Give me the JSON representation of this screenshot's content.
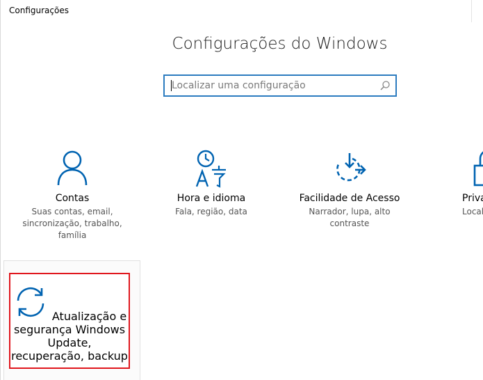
{
  "window": {
    "title": "Configurações"
  },
  "header": {
    "title": "Configurações do Windows"
  },
  "search": {
    "placeholder": "Localizar uma configuração",
    "value": ""
  },
  "tiles": [
    {
      "id": "contas",
      "icon": "person-icon",
      "label": "Contas",
      "desc": "Suas contas, email, sincronização, trabalho, família"
    },
    {
      "id": "hora",
      "icon": "time-language-icon",
      "label": "Hora e idioma",
      "desc": "Fala, região, data"
    },
    {
      "id": "facilidade",
      "icon": "ease-of-access-icon",
      "label": "Facilidade de Acesso",
      "desc": "Narrador, lupa, alto contraste"
    },
    {
      "id": "privacidade",
      "icon": "lock-icon",
      "label": "Priva",
      "desc": "Localiza"
    },
    {
      "id": "atualizacao",
      "icon": "sync-icon",
      "label": "Atualização e segurança",
      "desc": "Windows Update, recuperação, backup"
    }
  ],
  "colors": {
    "accent": "#0063b1",
    "highlight_border": "#e0161d",
    "search_border": "#2b7bbf"
  }
}
